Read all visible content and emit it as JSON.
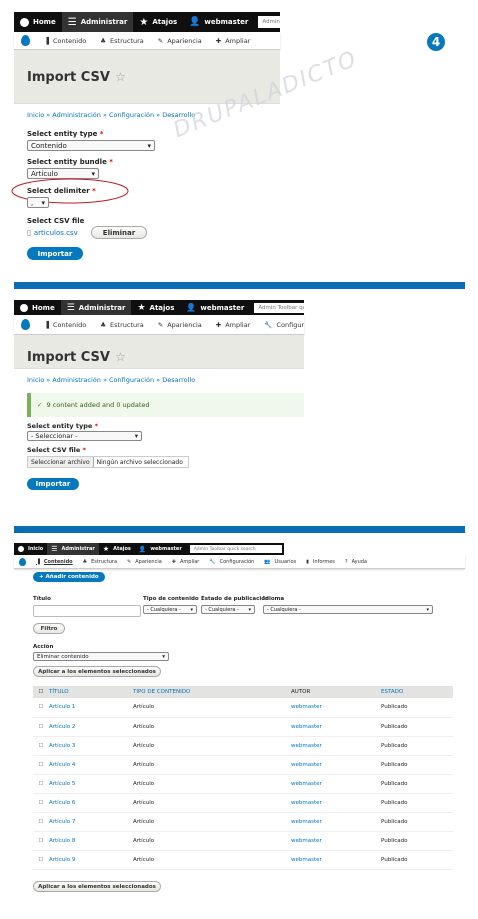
{
  "step_number": "4",
  "watermark": "DRUPALADICTO",
  "colors": {
    "accent": "#0678be",
    "toolbar": "#0f0f0f",
    "separator": "#0a6db5",
    "required": "#e00000"
  },
  "s1": {
    "toolbar": {
      "home": "Home",
      "admin": "Administrar",
      "shortcuts": "Atajos",
      "user": "webmaster",
      "search": "Admin Toolbar"
    },
    "tray": [
      "Contenido",
      "Estructura",
      "Apariencia",
      "Ampliar"
    ],
    "title": "Import CSV",
    "breadcrumb": "Inicio » Administración » Configuración » Desarrollo",
    "entity_type_label": "Select entity type",
    "entity_type_value": "Contenido",
    "bundle_label": "Select entity bundle",
    "bundle_value": "Artículo",
    "delimiter_label": "Select delimiter",
    "delimiter_value": ",",
    "file_label": "Select CSV file",
    "file_name": "articulos.csv",
    "remove_btn": "Eliminar",
    "import_btn": "Importar"
  },
  "s2": {
    "toolbar": {
      "home": "Home",
      "admin": "Administrar",
      "shortcuts": "Atajos",
      "user": "webmaster",
      "search": "Admin Toolbar quick search"
    },
    "tray": [
      "Contenido",
      "Estructura",
      "Apariencia",
      "Ampliar",
      "Configuración"
    ],
    "title": "Import CSV",
    "breadcrumb": "Inicio » Administración » Configuración » Desarrollo",
    "message": "9 content added and 0 updated",
    "entity_type_label": "Select entity type",
    "entity_type_value": "- Seleccionar -",
    "file_label": "Select CSV file",
    "file_btn": "Seleccionar archivo",
    "file_none": "Ningún archivo seleccionado",
    "import_btn": "Importar"
  },
  "s3": {
    "toolbar": {
      "home": "Inicio",
      "admin": "Administrar",
      "shortcuts": "Atajos",
      "user": "webmaster",
      "search": "Admin Toolbar quick search"
    },
    "tray": [
      "Contenido",
      "Estructura",
      "Apariencia",
      "Ampliar",
      "Configuración",
      "Usuarios",
      "Informes",
      "Ayuda"
    ],
    "add_btn": "+ Añadir contenido",
    "filters": {
      "title_label": "Título",
      "type_label": "Tipo de contenido",
      "type_value": "- Cualquiera -",
      "status_label": "Estado de publicación",
      "status_value": "- Cualquiera -",
      "lang_label": "Idioma",
      "lang_value": "- Cualquiera -",
      "filter_btn": "Filtro"
    },
    "action_label": "Acción",
    "action_value": "Eliminar contenido",
    "apply_btn": "Aplicar a los elementos seleccionados",
    "columns": [
      "TÍTULO",
      "TIPO DE CONTENIDO",
      "AUTOR",
      "ESTADO"
    ],
    "rows": [
      [
        "Artículo 1",
        "Artículo",
        "webmaster",
        "Publicado"
      ],
      [
        "Artículo 2",
        "Artículo",
        "webmaster",
        "Publicado"
      ],
      [
        "Artículo 3",
        "Artículo",
        "webmaster",
        "Publicado"
      ],
      [
        "Artículo 4",
        "Artículo",
        "webmaster",
        "Publicado"
      ],
      [
        "Artículo 5",
        "Artículo",
        "webmaster",
        "Publicado"
      ],
      [
        "Artículo 6",
        "Artículo",
        "webmaster",
        "Publicado"
      ],
      [
        "Artículo 7",
        "Artículo",
        "webmaster",
        "Publicado"
      ],
      [
        "Artículo 8",
        "Artículo",
        "webmaster",
        "Publicado"
      ],
      [
        "Artículo 9",
        "Artículo",
        "webmaster",
        "Publicado"
      ]
    ],
    "apply_btn_bottom": "Aplicar a los elementos seleccionados"
  }
}
